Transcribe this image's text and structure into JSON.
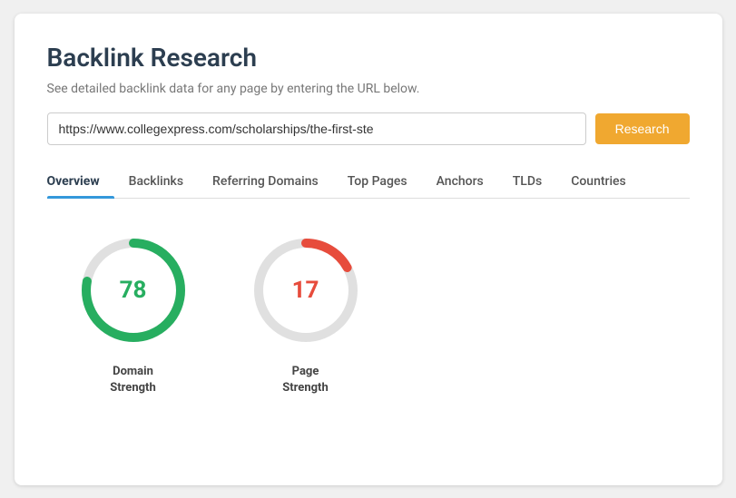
{
  "page": {
    "title": "Backlink Research",
    "subtitle": "See detailed backlink data for any page by entering the URL below.",
    "url_value": "https://www.collegexpress.com/scholarships/the-first-ste",
    "research_btn_label": "Research"
  },
  "tabs": [
    {
      "id": "overview",
      "label": "Overview",
      "active": true
    },
    {
      "id": "backlinks",
      "label": "Backlinks",
      "active": false
    },
    {
      "id": "referring-domains",
      "label": "Referring Domains",
      "active": false
    },
    {
      "id": "top-pages",
      "label": "Top Pages",
      "active": false
    },
    {
      "id": "anchors",
      "label": "Anchors",
      "active": false
    },
    {
      "id": "tlds",
      "label": "TLDs",
      "active": false
    },
    {
      "id": "countries",
      "label": "Countries",
      "active": false
    }
  ],
  "charts": [
    {
      "id": "domain-strength",
      "value": "78",
      "label_line1": "Domain",
      "label_line2": "Strength",
      "color": "green",
      "progress": 78,
      "track_color": "#e0e0e0",
      "fill_color": "#27ae60"
    },
    {
      "id": "page-strength",
      "value": "17",
      "label_line1": "Page",
      "label_line2": "Strength",
      "color": "red",
      "progress": 17,
      "track_color": "#e0e0e0",
      "fill_color": "#e74c3c"
    }
  ]
}
